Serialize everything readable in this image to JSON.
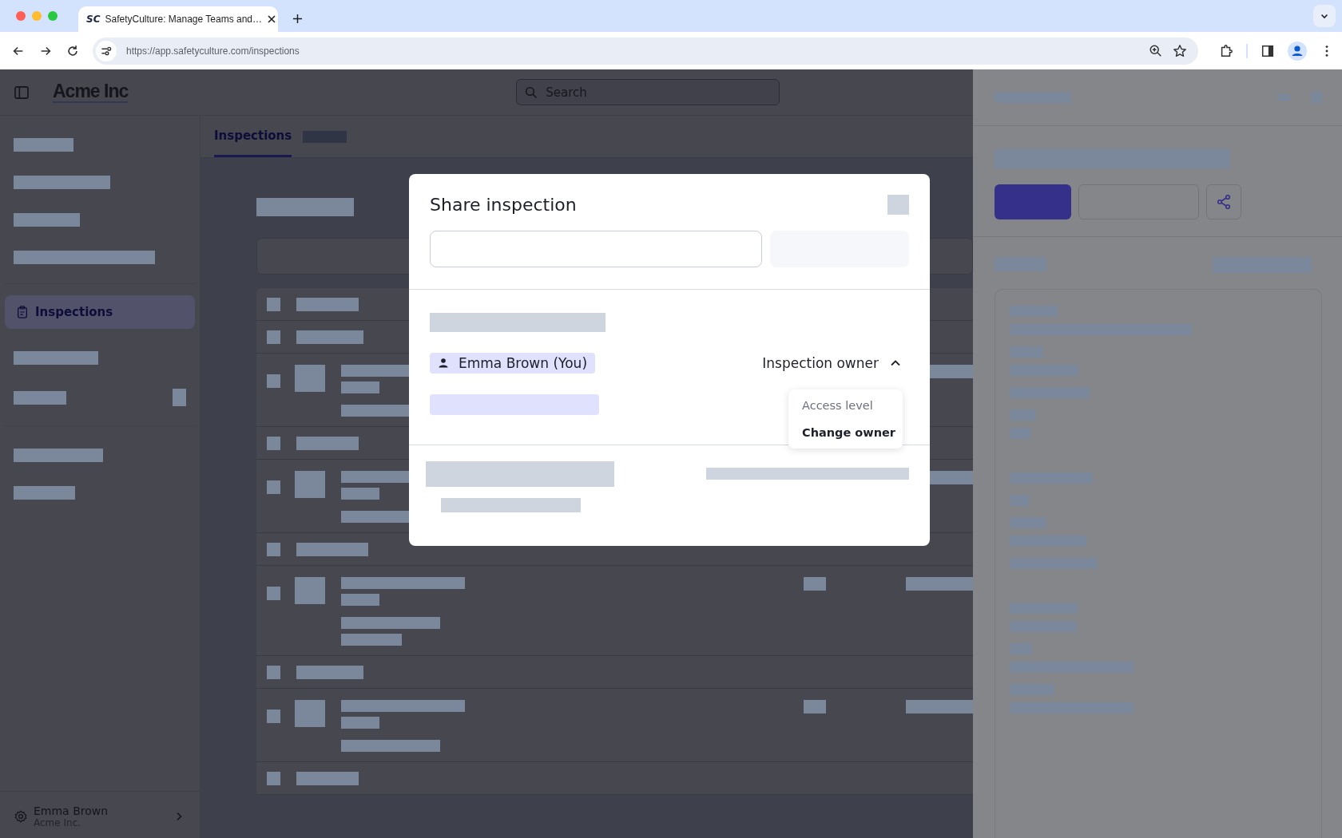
{
  "browser": {
    "tab": {
      "favicon": "SC",
      "title": "SafetyCulture: Manage Teams and…"
    },
    "url": "https://app.safetyculture.com/inspections"
  },
  "app": {
    "logo": "Acme Inc",
    "search": {
      "placeholder": "Search"
    },
    "sidebar": {
      "items": [
        {
          "label": "Inspections",
          "selected": true
        }
      ],
      "user": {
        "name": "Emma Brown",
        "org": "Acme Inc."
      }
    },
    "tabs": [
      {
        "label": "Inspections",
        "selected": true
      }
    ]
  },
  "dialog": {
    "title": "Share inspection",
    "owner": "Emma Brown (You)",
    "role": {
      "label": "Inspection owner",
      "expanded": true
    },
    "menu": {
      "heading": "Access level",
      "items": [
        "Change owner"
      ]
    }
  }
}
